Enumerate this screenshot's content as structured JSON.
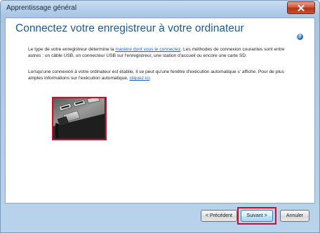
{
  "window": {
    "title": "Apprentissage général"
  },
  "main": {
    "heading": "Connectez votre enregistreur à votre ordinateur",
    "help_icon": "help-icon",
    "paragraph1": {
      "before_link": "Le type de votre enregistreur détermine la ",
      "link_text": "manière dont vous le connectez",
      "after_link": ". Les méthodes de connexion courantes sont entre autres : un câble USB, un connecteur USB sur l'enregistreur, une station d'accueil ou encore une carte SD."
    },
    "paragraph2": {
      "before_link": "Lorsqu'une connexion à votre ordinateur est établie, il se peut qu'une fenêtre d'exécution automatique s' affiche. Pour de plus amples informations sur l'exécution automatique, ",
      "link_text": "cliquez ici",
      "after_link": "."
    },
    "image_subject": "usb-plug-into-computer-ports"
  },
  "footer": {
    "prev_label": "< Précédent",
    "next_label": "Suivant >",
    "cancel_label": "Annuler"
  },
  "colors": {
    "heading": "#1e5a8a",
    "highlight": "#c8102e",
    "link": "#1f5fbf"
  }
}
